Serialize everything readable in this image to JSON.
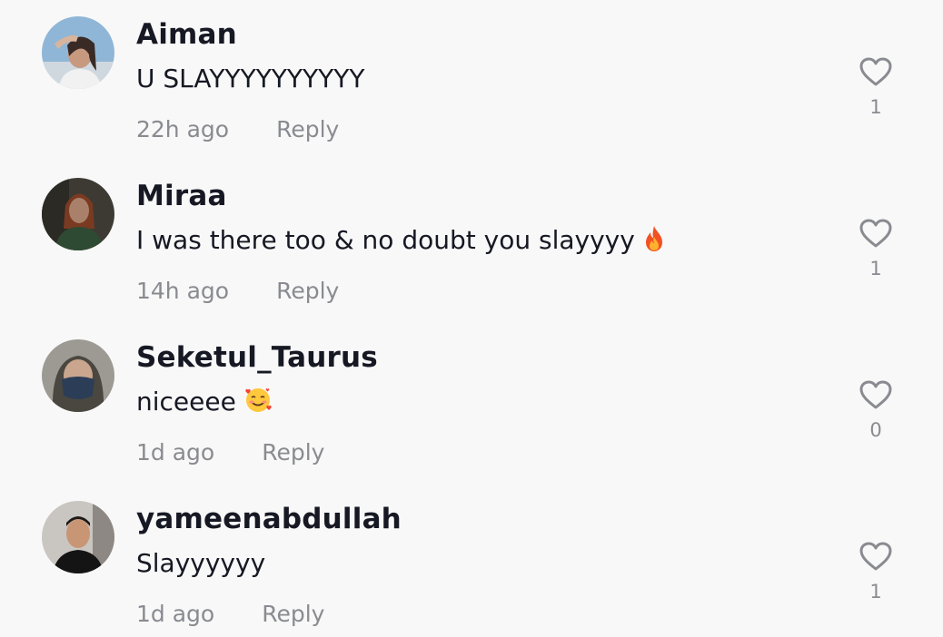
{
  "comments": [
    {
      "username": "Aiman",
      "text": "U SLAYYYYYYYYYY",
      "time": "22h ago",
      "reply_label": "Reply",
      "likes": "1",
      "icon": "heart-outline-icon"
    },
    {
      "username": "Miraa",
      "text": "I was there too & no doubt you slayyyy",
      "emoji": "fire-emoji",
      "time": "14h ago",
      "reply_label": "Reply",
      "likes": "1",
      "icon": "heart-outline-icon"
    },
    {
      "username": "Seketul_Taurus",
      "text": "niceeee",
      "emoji": "smiling-face-with-hearts-emoji",
      "time": "1d ago",
      "reply_label": "Reply",
      "likes": "0",
      "icon": "heart-outline-icon"
    },
    {
      "username": "yameenabdullah",
      "text": "Slayyyyyy",
      "time": "1d ago",
      "reply_label": "Reply",
      "likes": "1",
      "icon": "heart-outline-icon"
    }
  ],
  "colors": {
    "background": "#f8f8f8",
    "username": "#161823",
    "meta": "#8a8b91"
  }
}
